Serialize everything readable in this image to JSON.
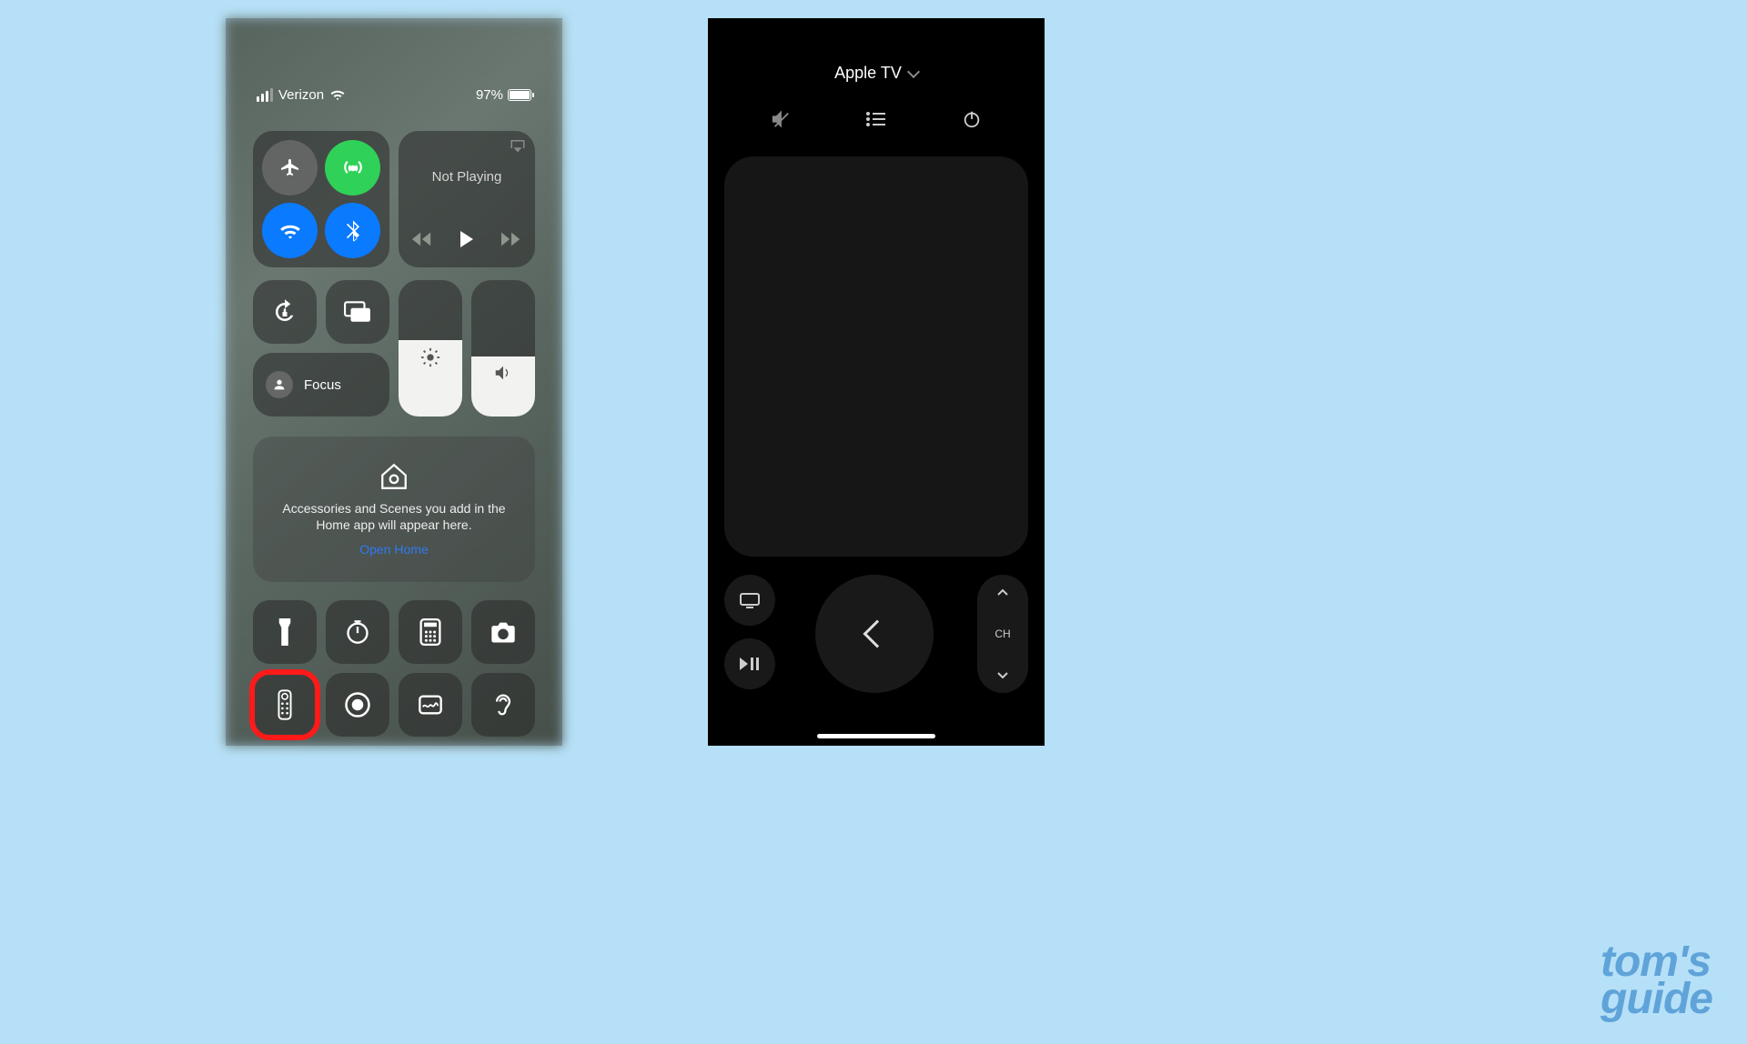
{
  "page_bg": "#b6e0f7",
  "watermark": {
    "line1": "tom's",
    "line2": "guide"
  },
  "left": {
    "status": {
      "carrier": "Verizon",
      "battery_pct": "97%"
    },
    "media": {
      "now_playing": "Not Playing"
    },
    "focus": {
      "label": "Focus"
    },
    "home": {
      "desc": "Accessories and Scenes you add in the Home app will appear here.",
      "link": "Open Home"
    },
    "connectivity": {
      "airplane": "off",
      "cellular": "on",
      "wifi": "on",
      "bluetooth": "on"
    },
    "bottom_icons": [
      "flashlight",
      "timer",
      "calculator",
      "camera",
      "apple-tv-remote",
      "screen-record",
      "freeform",
      "hearing"
    ],
    "highlighted_icon": "apple-tv-remote"
  },
  "right": {
    "device": "Apple TV",
    "channel_label": "CH"
  }
}
